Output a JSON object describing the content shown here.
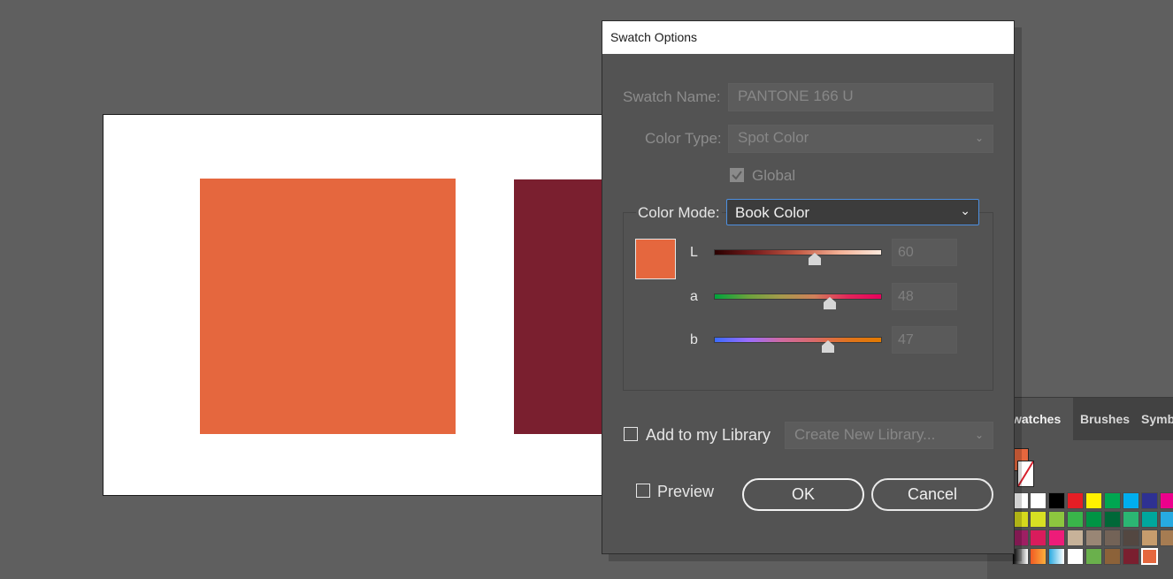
{
  "canvas": {
    "colors": {
      "background": "#5f5f5f",
      "artboard": "#ffffff",
      "orange": "#e5673e",
      "maroon": "#7a1f2f"
    }
  },
  "panel": {
    "tabs": [
      {
        "label": "watches",
        "active": true
      },
      {
        "label": "Brushes",
        "active": false
      },
      {
        "label": "Symb",
        "active": false
      }
    ]
  },
  "dialog": {
    "title": "Swatch Options",
    "swatch_name": {
      "label": "Swatch Name:",
      "value": "PANTONE 166 U"
    },
    "color_type": {
      "label": "Color Type:",
      "value": "Spot Color"
    },
    "global": {
      "label": "Global",
      "checked": true
    },
    "color_mode": {
      "label": "Color Mode:",
      "value": "Book Color"
    },
    "swatch_color": "#e5673e",
    "sliders": [
      {
        "label": "L",
        "value": "60",
        "fraction": 0.6
      },
      {
        "label": "a",
        "value": "48",
        "fraction": 0.69
      },
      {
        "label": "b",
        "value": "47",
        "fraction": 0.68
      }
    ],
    "library": {
      "label": "Add to my Library",
      "checked": false,
      "select_value": "Create New Library..."
    },
    "preview": {
      "label": "Preview",
      "checked": false
    },
    "ok_label": "OK",
    "cancel_label": "Cancel"
  }
}
